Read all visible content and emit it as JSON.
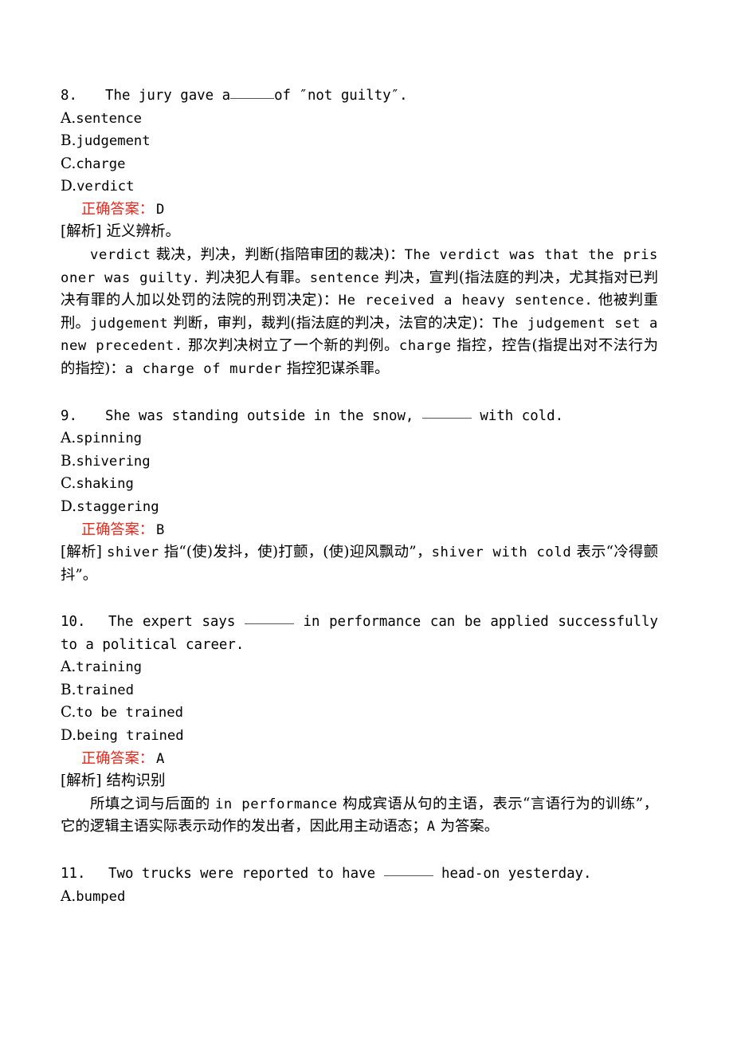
{
  "document": {
    "type": "exam-answer-key",
    "language": "zh-CN + en",
    "answer_label": "正确答案：",
    "explanation_tag": "[解析]",
    "accent_color": "#e8261b",
    "text_color": "#000000",
    "background_color": "#ffffff"
  },
  "questions": [
    {
      "number": "8.",
      "stem_pre": "The jury gave a",
      "stem_post": "of ″not guilty″.",
      "options": [
        {
          "letter": "A.",
          "text": "sentence"
        },
        {
          "letter": "B.",
          "text": "judgement"
        },
        {
          "letter": "C.",
          "text": "charge"
        },
        {
          "letter": "D.",
          "text": "verdict"
        }
      ],
      "answer": "D",
      "explanation_heading": "近义辨析。",
      "explanation_body": "verdict 裁决，判决，判断(指陪审团的裁决)：The verdict was that the prisoner was guilty. 判决犯人有罪。sentence 判决，宣判(指法庭的判决，尤其指对已判决有罪的人加以处罚的法院的刑罚决定)：He received a heavy sentence. 他被判重刑。judgement 判断，审判，裁判(指法庭的判决，法官的决定)：The judgement set a new precedent. 那次判决树立了一个新的判例。charge 指控，控告(指提出对不法行为的指控)：a charge of murder 指控犯谋杀罪。"
    },
    {
      "number": "9.",
      "stem_pre": "She was standing outside in the snow,",
      "stem_post": "with cold.",
      "options": [
        {
          "letter": "A.",
          "text": "spinning"
        },
        {
          "letter": "B.",
          "text": "shivering"
        },
        {
          "letter": "C.",
          "text": "shaking"
        },
        {
          "letter": "D.",
          "text": "staggering"
        }
      ],
      "answer": "B",
      "explanation_heading": "",
      "explanation_inline": "shiver 指“(使)发抖，使)打颤，(使)迎风飘动”，shiver with cold 表示“冷得颤抖”。",
      "explanation_body": ""
    },
    {
      "number": "10.",
      "stem_pre": "The expert says",
      "stem_post": "in performance can be applied successfully to a political career.",
      "options": [
        {
          "letter": "A.",
          "text": "training"
        },
        {
          "letter": "B.",
          "text": "trained"
        },
        {
          "letter": "C.",
          "text": "to be trained"
        },
        {
          "letter": "D.",
          "text": "being trained"
        }
      ],
      "answer": "A",
      "explanation_heading": "结构识别",
      "explanation_body": "所填之词与后面的 in performance 构成宾语从句的主语，表示“言语行为的训练”，它的逻辑主语实际表示动作的发出者，因此用主动语态；A 为答案。"
    },
    {
      "number": "11.",
      "stem_pre": "Two trucks were reported to have",
      "stem_post": "head-on yesterday.",
      "options": [
        {
          "letter": "A.",
          "text": "bumped"
        }
      ],
      "answer": "",
      "explanation_heading": "",
      "explanation_body": ""
    }
  ]
}
